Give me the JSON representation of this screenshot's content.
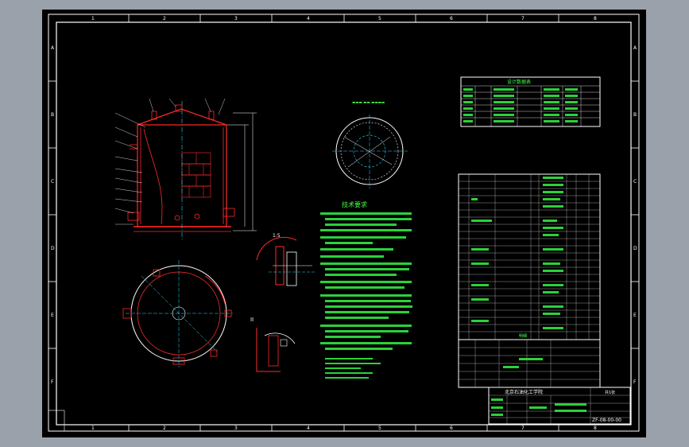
{
  "drawing": {
    "zones_top": [
      "1",
      "2",
      "3",
      "4",
      "5",
      "6",
      "7",
      "8"
    ],
    "zones_bottom": [
      "1",
      "2",
      "3",
      "4",
      "5",
      "6",
      "7",
      "8"
    ],
    "zones_side": [
      "A",
      "B",
      "C",
      "D",
      "E",
      "F"
    ],
    "tech_title": "技术要求",
    "section_label": "II",
    "section_b": "II",
    "scale_label": "1:5",
    "title_block": {
      "company": "北京石油化工学院",
      "drawing_no": "ZF-08-00-00",
      "sheet": "共1张"
    },
    "bom_header": "明细",
    "catalog_title": "设计数据表"
  },
  "colors": {
    "background": "#000000",
    "frame": "#ffffff",
    "outline": "#ff2a2a",
    "center_line": "#29d8ff",
    "text": "#46ff46"
  }
}
